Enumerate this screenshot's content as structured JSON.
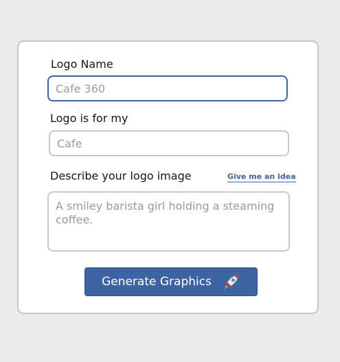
{
  "form": {
    "logo_name": {
      "label": "Logo Name",
      "placeholder": "Cafe 360"
    },
    "logo_for": {
      "label": "Logo is for my",
      "placeholder": "Cafe"
    },
    "describe": {
      "label": "Describe your logo image",
      "idea_link": "Give me an idea",
      "placeholder": "A smiley barista girl holding a steaming coffee."
    },
    "generate_label": "Generate Graphics",
    "icons": {
      "generate": "rocket-icon"
    }
  },
  "colors": {
    "accent": "#3e63a2",
    "background": "#ebebeb",
    "card": "#ffffff"
  }
}
